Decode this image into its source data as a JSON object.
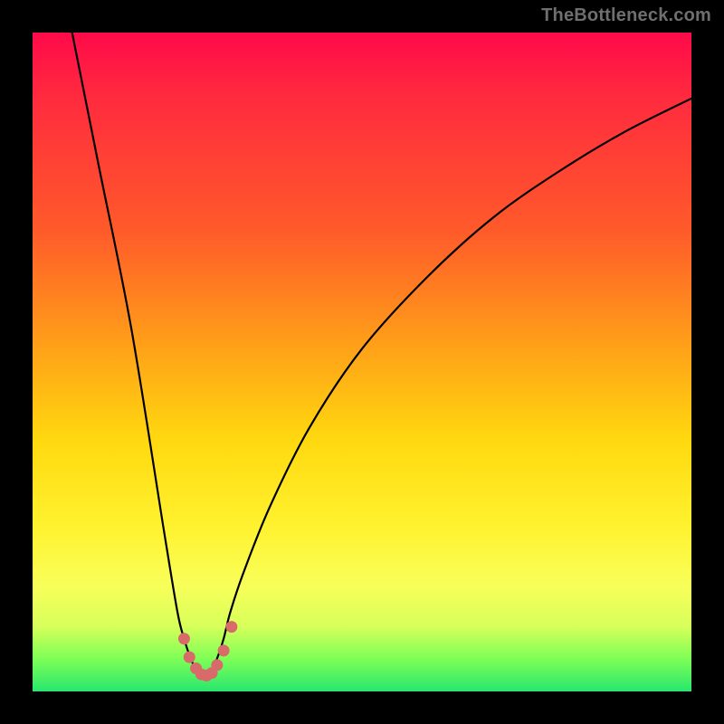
{
  "watermark": "TheBottleneck.com",
  "chart_data": {
    "type": "line",
    "title": "",
    "xlabel": "",
    "ylabel": "",
    "xlim": [
      0,
      100
    ],
    "ylim": [
      0,
      100
    ],
    "note": "V-shaped bottleneck curve; y is mismatch magnitude (0 = no bottleneck). Trough at x≈26.",
    "series": [
      {
        "name": "bottleneck-curve",
        "x": [
          6,
          10,
          15,
          20,
          22,
          23,
          24,
          25,
          26,
          27,
          28,
          29,
          30,
          32,
          36,
          42,
          50,
          60,
          70,
          80,
          90,
          100
        ],
        "values": [
          100,
          80,
          55,
          24,
          12,
          8,
          5,
          3,
          2,
          3,
          5,
          8,
          12,
          18,
          28,
          40,
          52,
          63,
          72,
          79,
          85,
          90
        ]
      }
    ],
    "markers": {
      "name": "trough-dots",
      "x": [
        23.0,
        23.8,
        24.8,
        25.6,
        26.4,
        27.2,
        28.0,
        29.0,
        30.2
      ],
      "values": [
        8.0,
        5.2,
        3.5,
        2.6,
        2.4,
        2.8,
        4.0,
        6.2,
        9.8
      ],
      "note": "cluster of points near the trough, sitting just above y=0",
      "color": "#d86a6a"
    },
    "background_gradient": {
      "direction": "top-to-bottom",
      "stops": [
        {
          "pos": 0.0,
          "color": "#ff0a4a"
        },
        {
          "pos": 0.1,
          "color": "#ff2b3e"
        },
        {
          "pos": 0.3,
          "color": "#ff5a2a"
        },
        {
          "pos": 0.48,
          "color": "#ffa218"
        },
        {
          "pos": 0.62,
          "color": "#ffd90f"
        },
        {
          "pos": 0.75,
          "color": "#fff22f"
        },
        {
          "pos": 0.84,
          "color": "#f8ff5a"
        },
        {
          "pos": 0.9,
          "color": "#d8ff5a"
        },
        {
          "pos": 0.95,
          "color": "#7fff56"
        },
        {
          "pos": 1.0,
          "color": "#28e66f"
        }
      ]
    }
  }
}
